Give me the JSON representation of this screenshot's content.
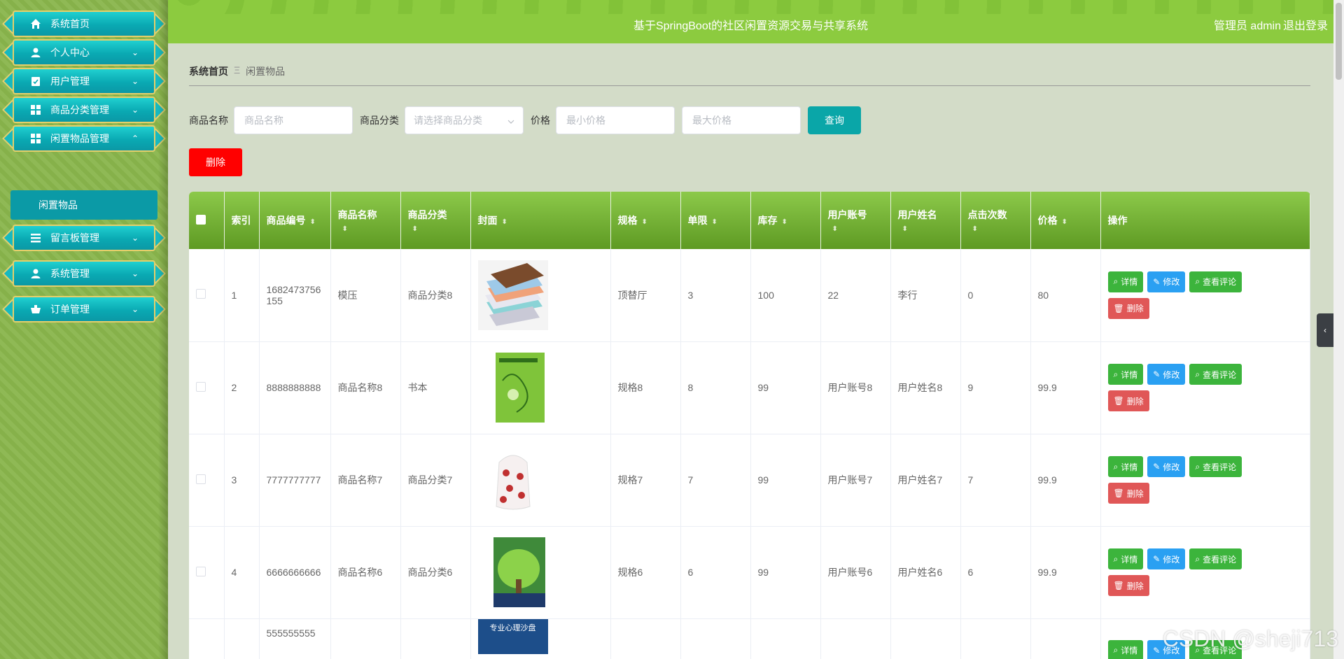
{
  "sidebar": {
    "items": [
      {
        "label": "系统首页",
        "icon": "home-icon",
        "arrow": ""
      },
      {
        "label": "个人中心",
        "icon": "user-icon",
        "arrow": "⌄"
      },
      {
        "label": "用户管理",
        "icon": "clipboard-icon",
        "arrow": "⌄"
      },
      {
        "label": "商品分类管理",
        "icon": "grid-icon",
        "arrow": "⌄"
      },
      {
        "label": "闲置物品管理",
        "icon": "grid-icon",
        "arrow": "⌃"
      },
      {
        "label": "留言板管理",
        "icon": "list-icon",
        "arrow": "⌄"
      },
      {
        "label": "系统管理",
        "icon": "user-icon",
        "arrow": "⌄"
      },
      {
        "label": "订单管理",
        "icon": "cart-icon",
        "arrow": "⌄"
      }
    ],
    "submenu": {
      "label": "闲置物品"
    }
  },
  "header": {
    "title": "基于SpringBoot的社区闲置资源交易与共享系统",
    "user": "管理员 admin",
    "logout": "退出登录"
  },
  "breadcrumb": {
    "home": "系统首页",
    "sep": "Ξ",
    "current": "闲置物品"
  },
  "search": {
    "name_label": "商品名称",
    "name_placeholder": "商品名称",
    "category_label": "商品分类",
    "category_placeholder": "请选择商品分类",
    "price_label": "价格",
    "min_placeholder": "最小价格",
    "max_placeholder": "最大价格",
    "query_button": "查询"
  },
  "toolbar": {
    "delete_button": "删除"
  },
  "table": {
    "headers": {
      "index": "索引",
      "code": "商品编号",
      "name": "商品名称",
      "category": "商品分类",
      "cover": "封面",
      "spec": "规格",
      "limit": "单限",
      "stock": "库存",
      "account": "用户账号",
      "username": "用户姓名",
      "clicks": "点击次数",
      "price": "价格",
      "ops": "操作"
    },
    "rows": [
      {
        "index": "1",
        "code": "1682473756155",
        "name": "模压",
        "category": "商品分类8",
        "spec": "顶替厅",
        "limit": "3",
        "stock": "100",
        "account": "22",
        "username": "李行",
        "clicks": "0",
        "price": "80"
      },
      {
        "index": "2",
        "code": "8888888888",
        "name": "商品名称8",
        "category": "书本",
        "spec": "规格8",
        "limit": "8",
        "stock": "99",
        "account": "用户账号8",
        "username": "用户姓名8",
        "clicks": "9",
        "price": "99.9"
      },
      {
        "index": "3",
        "code": "7777777777",
        "name": "商品名称7",
        "category": "商品分类7",
        "spec": "规格7",
        "limit": "7",
        "stock": "99",
        "account": "用户账号7",
        "username": "用户姓名7",
        "clicks": "7",
        "price": "99.9"
      },
      {
        "index": "4",
        "code": "6666666666",
        "name": "商品名称6",
        "category": "商品分类6",
        "spec": "规格6",
        "limit": "6",
        "stock": "99",
        "account": "用户账号6",
        "username": "用户姓名6",
        "clicks": "6",
        "price": "99.9"
      },
      {
        "index": "",
        "code": "555555555",
        "name": "",
        "category": "",
        "spec": "",
        "limit": "",
        "stock": "",
        "account": "",
        "username": "",
        "clicks": "",
        "price": ""
      }
    ],
    "ops": {
      "detail": "详情",
      "edit": "修改",
      "review": "查看评论",
      "delete": "删除"
    },
    "row5_cover_text": "专业心理沙盘"
  },
  "watermark": "CSDN @sheji713"
}
